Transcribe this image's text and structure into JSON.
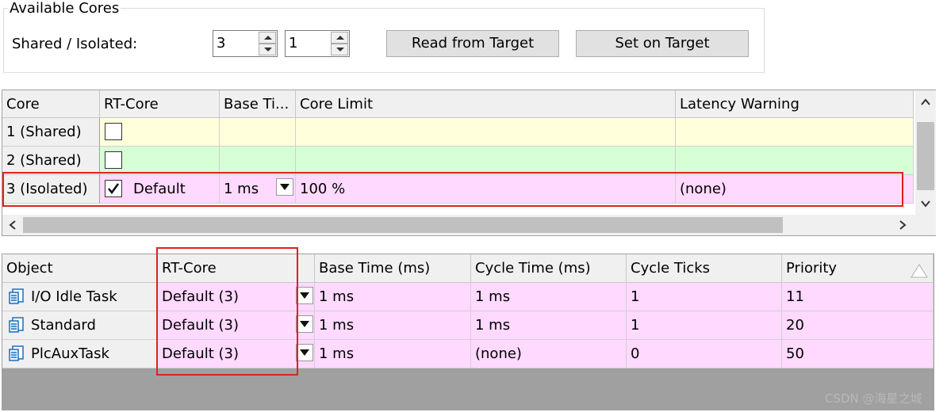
{
  "cores_group": {
    "title": "Available Cores",
    "shared_isolated_label": "Shared / Isolated:",
    "shared_value": "3",
    "isolated_value": "1",
    "read_button": "Read from Target",
    "set_button": "Set on Target"
  },
  "core_grid": {
    "columns": [
      "Core",
      "RT-Core",
      "Base Ti...",
      "Core Limit",
      "Latency Warning"
    ],
    "rows": [
      {
        "core": "1 (Shared)",
        "rt_checked": false,
        "rt_core": "",
        "base_time": "",
        "core_limit": "",
        "latency": ""
      },
      {
        "core": "2 (Shared)",
        "rt_checked": false,
        "rt_core": "",
        "base_time": "",
        "core_limit": "",
        "latency": ""
      },
      {
        "core": "3 (Isolated)",
        "rt_checked": true,
        "rt_core": "Default",
        "base_time": "1 ms",
        "core_limit": "100 %",
        "latency": "(none)"
      }
    ]
  },
  "task_grid": {
    "columns": [
      "Object",
      "RT-Core",
      "Base Time (ms)",
      "Cycle Time (ms)",
      "Cycle Ticks",
      "Priority"
    ],
    "rows": [
      {
        "object": "I/O Idle Task",
        "rt_core": "Default (3)",
        "base_time": "1 ms",
        "cycle_time": "1 ms",
        "cycle_ticks": "1",
        "priority": "11",
        "icon": "task-icon"
      },
      {
        "object": "Standard",
        "rt_core": "Default (3)",
        "base_time": "1 ms",
        "cycle_time": "1 ms",
        "cycle_ticks": "1",
        "priority": "20",
        "icon": "task-icon"
      },
      {
        "object": "PlcAuxTask",
        "rt_core": "Default (3)",
        "base_time": "1 ms",
        "cycle_time": "(none)",
        "cycle_ticks": "0",
        "priority": "50",
        "icon": "task-icon"
      }
    ]
  },
  "watermark": "CSDN @海星之城",
  "colors": {
    "highlight_border": "#e02020",
    "shared_row": "#ffffdc",
    "shared_row2": "#d6ffd6",
    "isolated_row": "#ffd9ff"
  }
}
